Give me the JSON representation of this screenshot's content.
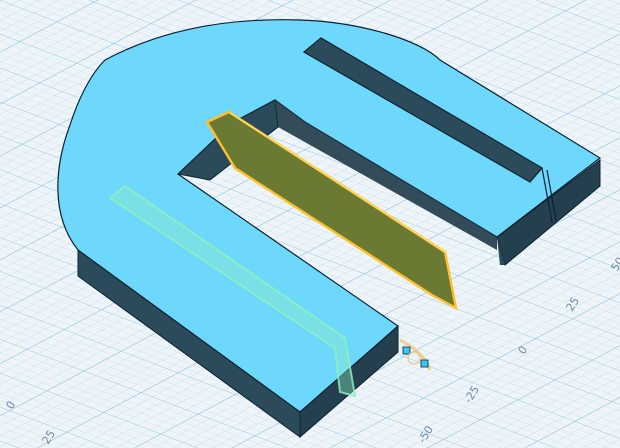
{
  "viewport": {
    "background": "#eef4f8",
    "grid_color": "#9fd3ee",
    "grid_major_color": "#6fb6e0"
  },
  "model": {
    "body_top_color": "#6dd8fb",
    "body_side_color": "#2b4a5a",
    "edge_color": "#0d2230",
    "selected_panel_color": "#6b7a33",
    "selected_outline_color": "#ffc02a",
    "ghost_strip_color": "#8ff0c0"
  },
  "grid_labels": {
    "left": [
      "0",
      "25"
    ],
    "bottom": [
      "-50",
      "-25",
      "0",
      "25",
      "50"
    ]
  },
  "gizmo": {
    "icon": "move-handle-icon",
    "color": "#38c8f5"
  }
}
